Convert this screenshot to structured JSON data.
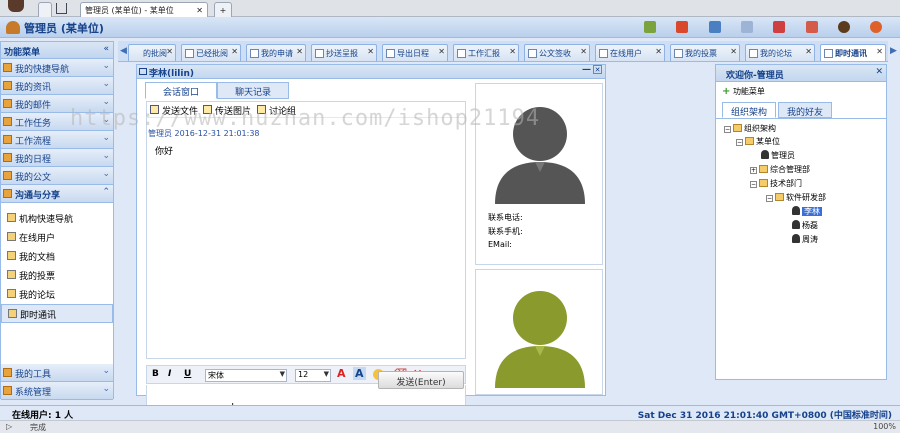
{
  "browser": {
    "tab_title": "管理员 (某单位) - 某单位",
    "new_tab": "+"
  },
  "app": {
    "title": "管理员 (某单位)"
  },
  "sidebar": {
    "header": "功能菜单",
    "collapse": "«",
    "sections": [
      {
        "label": "我的快捷导航"
      },
      {
        "label": "我的资讯"
      },
      {
        "label": "我的邮件"
      },
      {
        "label": "工作任务"
      },
      {
        "label": "工作流程"
      },
      {
        "label": "我的日程"
      },
      {
        "label": "我的公文"
      },
      {
        "label": "沟通与分享"
      }
    ],
    "items": [
      {
        "label": "机构快速导航"
      },
      {
        "label": "在线用户"
      },
      {
        "label": "我的文档"
      },
      {
        "label": "我的投票"
      },
      {
        "label": "我的论坛"
      },
      {
        "label": "即时通讯"
      }
    ],
    "bottom_sections": [
      {
        "label": "我的工具"
      },
      {
        "label": "系统管理"
      }
    ]
  },
  "tabs": [
    {
      "label": "的批阅"
    },
    {
      "label": "已经批阅"
    },
    {
      "label": "我的申请"
    },
    {
      "label": "抄送呈报"
    },
    {
      "label": "导出日程"
    },
    {
      "label": "工作汇报"
    },
    {
      "label": "公文签收"
    },
    {
      "label": "在线用户"
    },
    {
      "label": "我的投票"
    },
    {
      "label": "我的论坛"
    },
    {
      "label": "即时通讯"
    }
  ],
  "chat": {
    "window_title": "李林(lilin)",
    "tabs": {
      "chat": "会话窗口",
      "history": "聊天记录"
    },
    "toolbar": {
      "send_file": "发送文件",
      "send_image": "传送图片",
      "discuss": "讨论组"
    },
    "message": {
      "meta": "管理员 2016-12-31 21:01:38",
      "text": "你好"
    },
    "format": {
      "bold": "B",
      "italic": "I",
      "underline": "U",
      "font": "宋体",
      "size": "12"
    },
    "send_button": "发送(Enter)",
    "contact_info": {
      "phone": "联系电话:",
      "mobile": "联系手机:",
      "email": "EMail:"
    }
  },
  "right_panel": {
    "title": "欢迎你-管理员",
    "menu_button": "功能菜单",
    "tabs": {
      "org": "组织架构",
      "friends": "我的好友"
    },
    "tree": {
      "root": "组织架构",
      "unit": "某单位",
      "admin": "管理员",
      "dept1": "综合管理部",
      "dept2": "技术部门",
      "subdept": "软件研发部",
      "user1": "李林",
      "user2": "杨磊",
      "user3": "周涛"
    }
  },
  "status": {
    "online": "在线用户: 1 人",
    "datetime": "Sat Dec 31 2016 21:01:40 GMT+0800 (中国标准时间)"
  },
  "bottom": {
    "done": "完成",
    "zoom": "100%"
  },
  "watermark": "https://www.huzhan.com/ishop21194",
  "colors": {
    "accent": "#15428b",
    "panel_border": "#99bbe8",
    "avatar_dark": "#555555",
    "avatar_green": "#8a9a2c"
  }
}
